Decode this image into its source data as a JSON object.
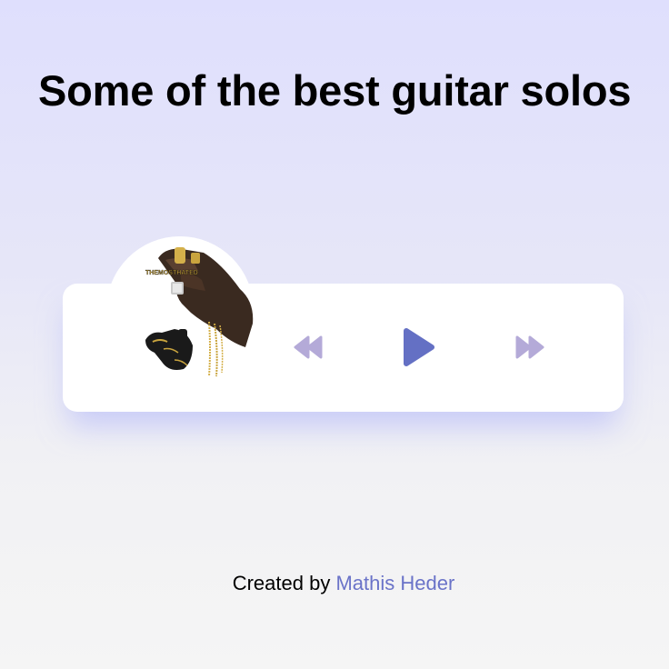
{
  "header": {
    "title": "Some of the best guitar solos"
  },
  "player": {
    "album_art_icon": "album-cover-hands-chains",
    "album_art_text": "THEMOSTHATED",
    "controls": {
      "rewind_icon": "rewind-icon",
      "play_icon": "play-icon",
      "forward_icon": "fast-forward-icon"
    },
    "colors": {
      "play": "#6470c4",
      "skip": "#b4aad8",
      "card": "#ffffff"
    }
  },
  "footer": {
    "credit_prefix": "Created by ",
    "author_name": "Mathis Heder",
    "author_color": "#6a73c8"
  }
}
